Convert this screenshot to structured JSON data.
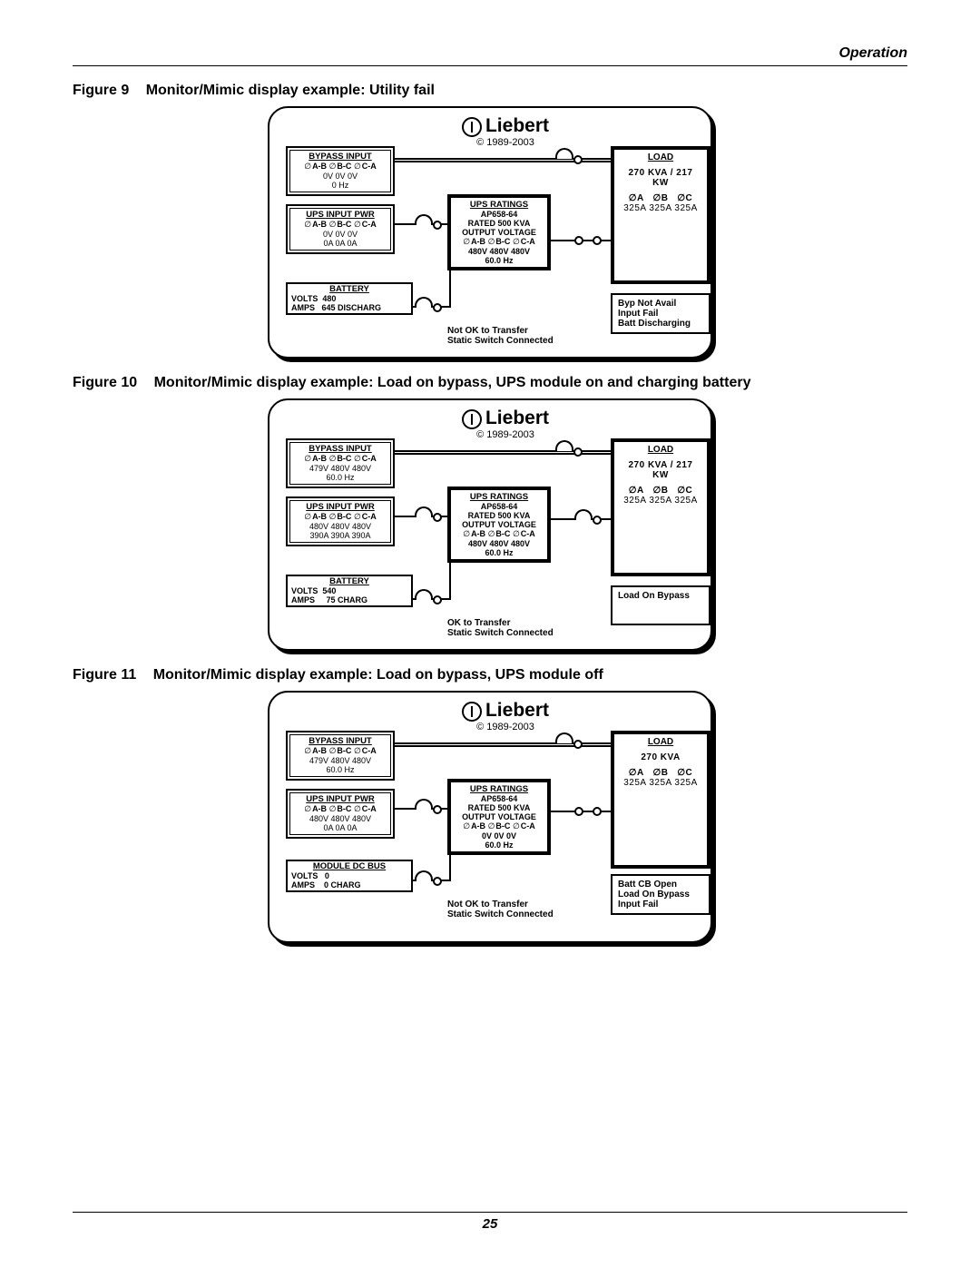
{
  "header": {
    "section": "Operation"
  },
  "footer": {
    "page": "25"
  },
  "brand": {
    "name": "Liebert",
    "copyright": "© 1989-2003"
  },
  "figures": [
    {
      "number": "Figure 9",
      "caption": "Monitor/Mimic display example: Utility fail"
    },
    {
      "number": "Figure 10",
      "caption": "Monitor/Mimic display example: Load on bypass, UPS module on and charging battery"
    },
    {
      "number": "Figure 11",
      "caption": "Monitor/Mimic display example: Load on bypass, UPS module off"
    }
  ],
  "panels": {
    "p1": {
      "bypass": {
        "title": "BYPASS INPUT",
        "phases": "A-B   B-C   C-A",
        "volts": "0V    0V    0V",
        "hz": "0 Hz"
      },
      "ups_in": {
        "title": "UPS INPUT PWR",
        "phases": "A-B   B-C   C-A",
        "volts": "0V    0V    0V",
        "amps": "0A    0A    0A"
      },
      "battery": {
        "title": "BATTERY",
        "volts": "VOLTS  480",
        "amps": "AMPS   645 DISCHARG"
      },
      "ratings": {
        "title": "UPS RATINGS",
        "model": "AP658-64",
        "rated": "RATED 500 KVA",
        "ov": "OUTPUT VOLTAGE",
        "phases": "A-B   B-C   C-A",
        "volts": "480V   480V   480V",
        "hz": "60.0 Hz"
      },
      "load": {
        "title": "LOAD",
        "kva": "270 KVA / 217 KW",
        "phases": "A        B        C",
        "amps": "325A   325A   325A"
      },
      "status": [
        "Byp Not Avail",
        "Input Fail",
        "Batt Discharging"
      ],
      "transfer": [
        "Not OK to Transfer",
        "Static Switch Connected"
      ]
    },
    "p2": {
      "bypass": {
        "title": "BYPASS INPUT",
        "phases": "A-B   B-C   C-A",
        "volts": "479V  480V  480V",
        "hz": "60.0 Hz"
      },
      "ups_in": {
        "title": "UPS INPUT PWR",
        "phases": "A-B   B-C   C-A",
        "volts": "480V  480V  480V",
        "amps": "390A  390A  390A"
      },
      "battery": {
        "title": "BATTERY",
        "volts": "VOLTS  540",
        "amps": "AMPS     75 CHARG"
      },
      "ratings": {
        "title": "UPS RATINGS",
        "model": "AP658-64",
        "rated": "RATED 500 KVA",
        "ov": "OUTPUT VOLTAGE",
        "phases": "A-B   B-C   C-A",
        "volts": "480V   480V   480V",
        "hz": "60.0 Hz"
      },
      "load": {
        "title": "LOAD",
        "kva": "270 KVA / 217 KW",
        "phases": "A        B        C",
        "amps": "325A   325A   325A"
      },
      "status": [
        "Load On Bypass"
      ],
      "transfer": [
        "OK to Transfer",
        "Static Switch Connected"
      ]
    },
    "p3": {
      "bypass": {
        "title": "BYPASS INPUT",
        "phases": "A-B   B-C   C-A",
        "volts": "479V  480V  480V",
        "hz": "60.0 Hz"
      },
      "ups_in": {
        "title": "UPS INPUT PWR",
        "phases": "A-B   B-C   C-A",
        "volts": "480V  480V  480V",
        "amps": "0A     0A     0A"
      },
      "battery": {
        "title": "MODULE DC BUS",
        "volts": "VOLTS   0",
        "amps": "AMPS    0 CHARG"
      },
      "ratings": {
        "title": "UPS RATINGS",
        "model": "AP658-64",
        "rated": "RATED 500 KVA",
        "ov": "OUTPUT VOLTAGE",
        "phases": "A-B   B-C   C-A",
        "volts": "0V     0V     0V",
        "hz": "60.0 Hz"
      },
      "load": {
        "title": "LOAD",
        "kva": "270 KVA",
        "phases": "A        B        C",
        "amps": "325A   325A   325A"
      },
      "status": [
        "Batt CB Open",
        "Load On Bypass",
        "Input Fail"
      ],
      "transfer": [
        "Not OK to Transfer",
        "Static Switch Connected"
      ]
    }
  }
}
